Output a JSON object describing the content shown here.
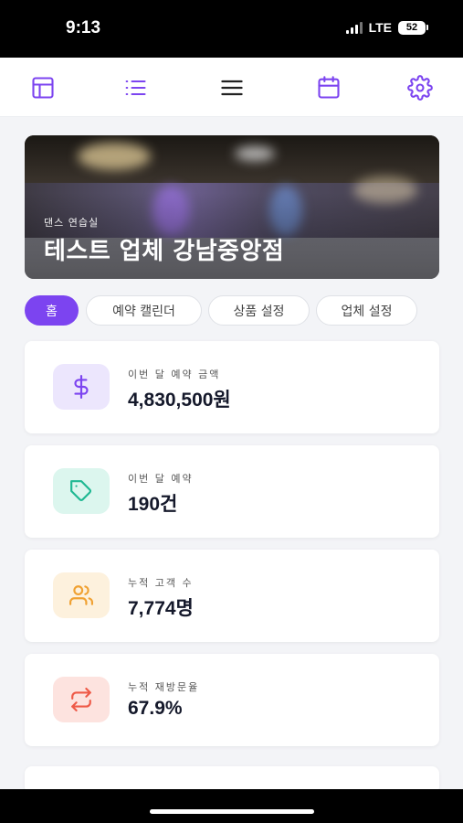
{
  "status_bar": {
    "time": "9:13",
    "network": "LTE",
    "battery": "52"
  },
  "topnav": {
    "items": [
      {
        "icon": "dashboard-layout-icon"
      },
      {
        "icon": "list-icon"
      },
      {
        "icon": "hamburger-menu-icon"
      },
      {
        "icon": "calendar-icon"
      },
      {
        "icon": "settings-gear-icon"
      }
    ],
    "accent_color": "#7c44f0"
  },
  "hero": {
    "subtitle": "댄스 연습실",
    "title": "테스트 업체 강남중앙점"
  },
  "tabs": [
    {
      "label": "홈",
      "active": true
    },
    {
      "label": "예약 캘린더",
      "active": false
    },
    {
      "label": "상품 설정",
      "active": false
    },
    {
      "label": "업체 설정",
      "active": false
    }
  ],
  "stats": [
    {
      "label": "이번 달 예약 금액",
      "value": "4,830,500원",
      "icon": "dollar-icon",
      "icon_color": "#7c44f0",
      "bg_color": "#ece6fd"
    },
    {
      "label": "이번 달 예약",
      "value": "190건",
      "icon": "tag-icon",
      "icon_color": "#1fb892",
      "bg_color": "#dcf6ee"
    },
    {
      "label": "누적 고객 수",
      "value": "7,774명",
      "icon": "users-icon",
      "icon_color": "#f0a132",
      "bg_color": "#fdf1dd"
    },
    {
      "label": "누적 재방문율",
      "value": "67.9%",
      "icon": "repeat-icon",
      "icon_color": "#ee5a48",
      "bg_color": "#fde3df"
    }
  ]
}
